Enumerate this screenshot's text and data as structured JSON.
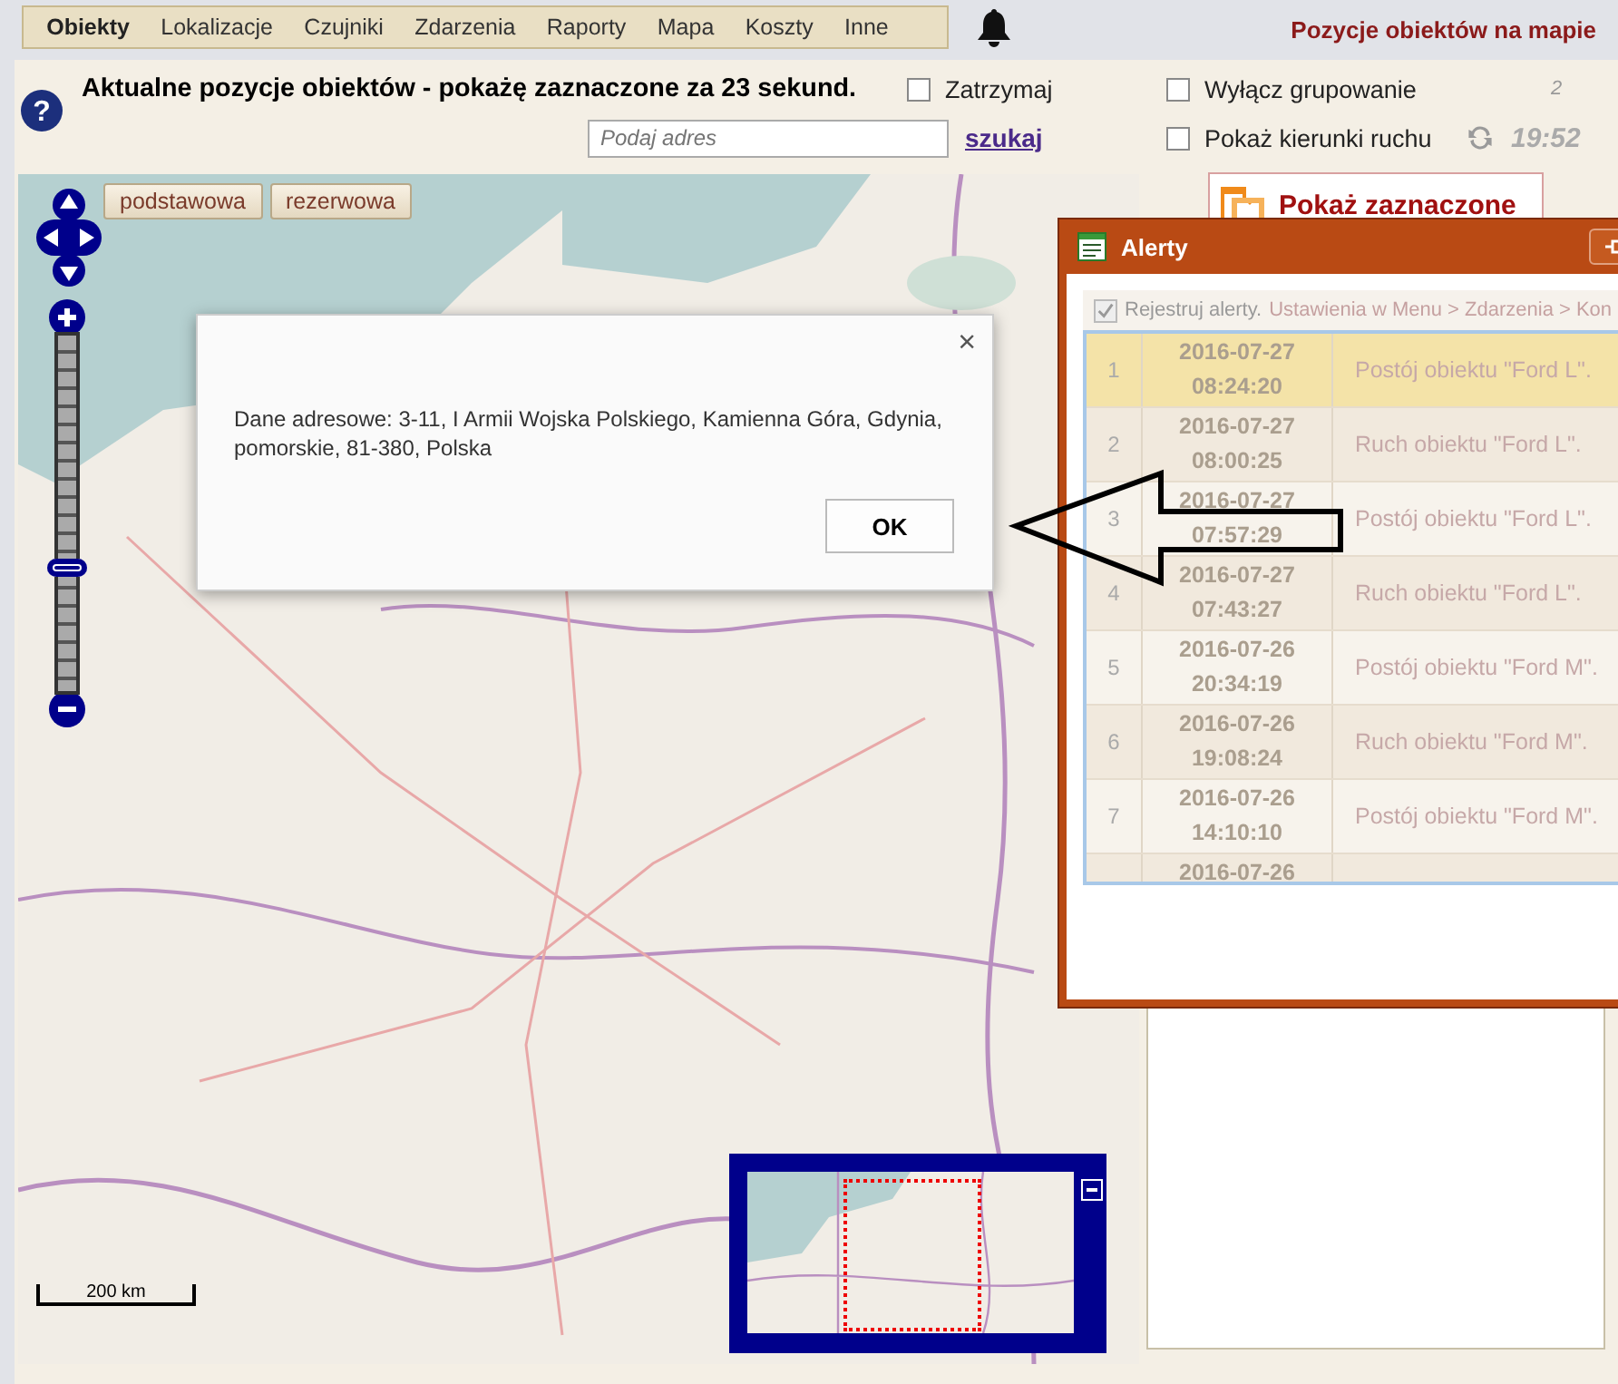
{
  "nav": {
    "tabs": [
      {
        "label": "Obiekty",
        "selected": true
      },
      {
        "label": "Lokalizacje",
        "selected": false
      },
      {
        "label": "Czujniki",
        "selected": false
      },
      {
        "label": "Zdarzenia",
        "selected": false
      },
      {
        "label": "Raporty",
        "selected": false
      },
      {
        "label": "Mapa",
        "selected": false
      },
      {
        "label": "Koszty",
        "selected": false
      },
      {
        "label": "Inne",
        "selected": false
      }
    ]
  },
  "page_title": "Pozycje obiektów na mapie",
  "toolbar": {
    "heading": "Aktualne pozycje obiektów - pokażę zaznaczone za 23 sekund.",
    "options": [
      {
        "label": "Zatrzymaj",
        "checked": false
      },
      {
        "label": "Wyłącz grupowanie",
        "checked": false
      },
      {
        "label": "Pokaż kierunki ruchu",
        "checked": false
      }
    ],
    "help": "?",
    "counter": "2",
    "address": {
      "placeholder": "Podaj adres"
    },
    "search_link": "szukaj",
    "time": "19:52"
  },
  "map": {
    "layers": [
      {
        "label": "podstawowa"
      },
      {
        "label": "rezerwowa"
      }
    ],
    "zoom": {
      "level": 0.35
    },
    "scale": "200 km"
  },
  "show_selected_button": "Pokaż zaznaczone",
  "dialog": {
    "message": "Dane adresowe: 3-11, I Armii Wojska Polskiego, Kamienna Góra, Gdynia, pomorskie, 81-380, Polska",
    "close": "×",
    "ok": "OK"
  },
  "alerts": {
    "title": "Alerty",
    "register": {
      "label": "Rejestruj alerty.",
      "checked": true
    },
    "settings_path": "Ustawienia w Menu > Zdarzenia > Kon",
    "rows": [
      {
        "number": "1",
        "date": "2016-07-27",
        "time": "08:24:20",
        "message": "Postój obiektu \"Ford L\".",
        "selected": true
      },
      {
        "number": "2",
        "date": "2016-07-27",
        "time": "08:00:25",
        "message": "Ruch obiektu \"Ford L\".",
        "selected": false
      },
      {
        "number": "3",
        "date": "2016-07-27",
        "time": "07:57:29",
        "message": "Postój obiektu \"Ford L\".",
        "selected": false
      },
      {
        "number": "4",
        "date": "2016-07-27",
        "time": "07:43:27",
        "message": "Ruch obiektu \"Ford L\".",
        "selected": false
      },
      {
        "number": "5",
        "date": "2016-07-26",
        "time": "20:34:19",
        "message": "Postój obiektu \"Ford M\".",
        "selected": false
      },
      {
        "number": "6",
        "date": "2016-07-26",
        "time": "19:08:24",
        "message": "Ruch obiektu \"Ford M\".",
        "selected": false
      },
      {
        "number": "7",
        "date": "2016-07-26",
        "time": "14:10:10",
        "message": "Postój obiektu \"Ford M\".",
        "selected": false
      },
      {
        "date": "2016-07-26",
        "selected": false
      }
    ]
  }
}
